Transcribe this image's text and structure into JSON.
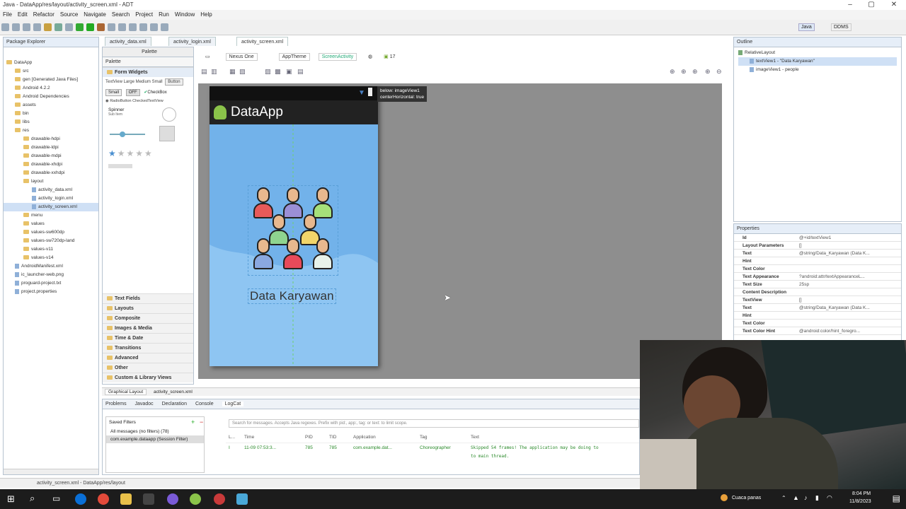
{
  "window": {
    "title": "Java - DataApp/res/layout/activity_screen.xml - ADT"
  },
  "menu": [
    "File",
    "Edit",
    "Refactor",
    "Source",
    "Navigate",
    "Search",
    "Project",
    "Run",
    "Window",
    "Help"
  ],
  "perspectives": {
    "java": "Java",
    "ddms": "DDMS"
  },
  "package_explorer": {
    "tab_label": "Package Explorer",
    "items": [
      {
        "label": "DataApp",
        "indent": 0,
        "kind": "project"
      },
      {
        "label": "src",
        "indent": 1,
        "kind": "folder"
      },
      {
        "label": "gen [Generated Java Files]",
        "indent": 1,
        "kind": "folder"
      },
      {
        "label": "Android 4.2.2",
        "indent": 1,
        "kind": "folder"
      },
      {
        "label": "Android Dependencies",
        "indent": 1,
        "kind": "folder"
      },
      {
        "label": "assets",
        "indent": 1,
        "kind": "folder"
      },
      {
        "label": "bin",
        "indent": 1,
        "kind": "folder"
      },
      {
        "label": "libs",
        "indent": 1,
        "kind": "folder"
      },
      {
        "label": "res",
        "indent": 1,
        "kind": "folder"
      },
      {
        "label": "drawable-hdpi",
        "indent": 2,
        "kind": "folder"
      },
      {
        "label": "drawable-ldpi",
        "indent": 2,
        "kind": "folder"
      },
      {
        "label": "drawable-mdpi",
        "indent": 2,
        "kind": "folder"
      },
      {
        "label": "drawable-xhdpi",
        "indent": 2,
        "kind": "folder"
      },
      {
        "label": "drawable-xxhdpi",
        "indent": 2,
        "kind": "folder"
      },
      {
        "label": "layout",
        "indent": 2,
        "kind": "folder"
      },
      {
        "label": "activity_data.xml",
        "indent": 3,
        "kind": "file"
      },
      {
        "label": "activity_login.xml",
        "indent": 3,
        "kind": "file"
      },
      {
        "label": "activity_screen.xml",
        "indent": 3,
        "kind": "file",
        "selected": true
      },
      {
        "label": "menu",
        "indent": 2,
        "kind": "folder"
      },
      {
        "label": "values",
        "indent": 2,
        "kind": "folder"
      },
      {
        "label": "values-sw600dp",
        "indent": 2,
        "kind": "folder"
      },
      {
        "label": "values-sw720dp-land",
        "indent": 2,
        "kind": "folder"
      },
      {
        "label": "values-v11",
        "indent": 2,
        "kind": "folder"
      },
      {
        "label": "values-v14",
        "indent": 2,
        "kind": "folder"
      },
      {
        "label": "AndroidManifest.xml",
        "indent": 1,
        "kind": "file"
      },
      {
        "label": "ic_launcher-web.png",
        "indent": 1,
        "kind": "file"
      },
      {
        "label": "proguard-project.txt",
        "indent": 1,
        "kind": "file"
      },
      {
        "label": "project.properties",
        "indent": 1,
        "kind": "file"
      }
    ]
  },
  "editor_tabs": [
    "activity_data.xml",
    "activity_login.xml",
    "activity_screen.xml"
  ],
  "palette": {
    "header": "Palette",
    "sub": "Palette",
    "group_open": "Form Widgets",
    "widget_text": "TextView Large Medium Small",
    "button": "Button",
    "small_btn": "Small",
    "off_btn": "OFF",
    "checkbox": "CheckBox",
    "radio": "RadioButton CheckedTextView",
    "spinner": "Spinner",
    "spinner_sub": "Sub Item",
    "categories": [
      "Text Fields",
      "Layouts",
      "Composite",
      "Images & Media",
      "Time & Date",
      "Transitions",
      "Advanced",
      "Other",
      "Custom & Library Views"
    ]
  },
  "layout_toolbar": {
    "device": "Nexus One",
    "theme": "AppTheme",
    "activity": "ScreenActivity",
    "api": "17"
  },
  "device": {
    "app_title": "DataApp",
    "label": "Data Karyawan"
  },
  "tooltip": {
    "line1": "below: imageView1",
    "line2": "centerHorizontal: true"
  },
  "bottom_editor_tabs": [
    "Graphical Layout",
    "activity_screen.xml"
  ],
  "outline": {
    "header": "Outline",
    "items": [
      "RelativeLayout",
      "textView1 - \"Data Karyawan\"",
      "imageView1 - people"
    ]
  },
  "properties": {
    "header": "Properties",
    "rows": [
      {
        "k": "Id",
        "v": "@+id/textView1"
      },
      {
        "k": "Layout Parameters",
        "v": "[]"
      },
      {
        "k": "Text",
        "v": "@string/Data_Karyawan (Data K..."
      },
      {
        "k": "Hint",
        "v": ""
      },
      {
        "k": "Text Color",
        "v": ""
      },
      {
        "k": "Text Appearance",
        "v": "?android:attr/textAppearanceL..."
      },
      {
        "k": "Text Size",
        "v": "25sp"
      },
      {
        "k": "Content Description",
        "v": ""
      },
      {
        "k": "TextView",
        "v": "[]"
      },
      {
        "k": "Text",
        "v": "@string/Data_Karyawan (Data K..."
      },
      {
        "k": "Hint",
        "v": ""
      },
      {
        "k": "Text Color",
        "v": ""
      },
      {
        "k": "Text Color Hint",
        "v": "@android:color/hint_foregro..."
      }
    ]
  },
  "bottom_views": [
    "Problems",
    "Javadoc",
    "Declaration",
    "Console",
    "LogCat"
  ],
  "logcat": {
    "saved_filters": "Saved Filters",
    "filters": [
      "All messages (no filters) (78)",
      "com.example.dataapp (Session Filter)"
    ],
    "search_placeholder": "Search for messages. Accepts Java regexes. Prefix with pid:, app:, tag: or text: to limit scope.",
    "columns": [
      "L...",
      "Time",
      "PID",
      "TID",
      "Application",
      "Tag",
      "Text"
    ],
    "row": [
      "I",
      "11-09 07:53:3...",
      "785",
      "785",
      "com.example.dat...",
      "Choreographer",
      "Skipped 54 frames! The application may be doing to"
    ],
    "row_cont": "to main thread."
  },
  "status_line": "activity_screen.xml - DataApp/res/layout",
  "taskbar": {
    "weather": "Cuaca panas",
    "time": "8:04 PM",
    "date": "11/8/2023"
  },
  "colors": {
    "android_blue": "#75b4ea",
    "canvas_gray": "#8e8e8e"
  }
}
